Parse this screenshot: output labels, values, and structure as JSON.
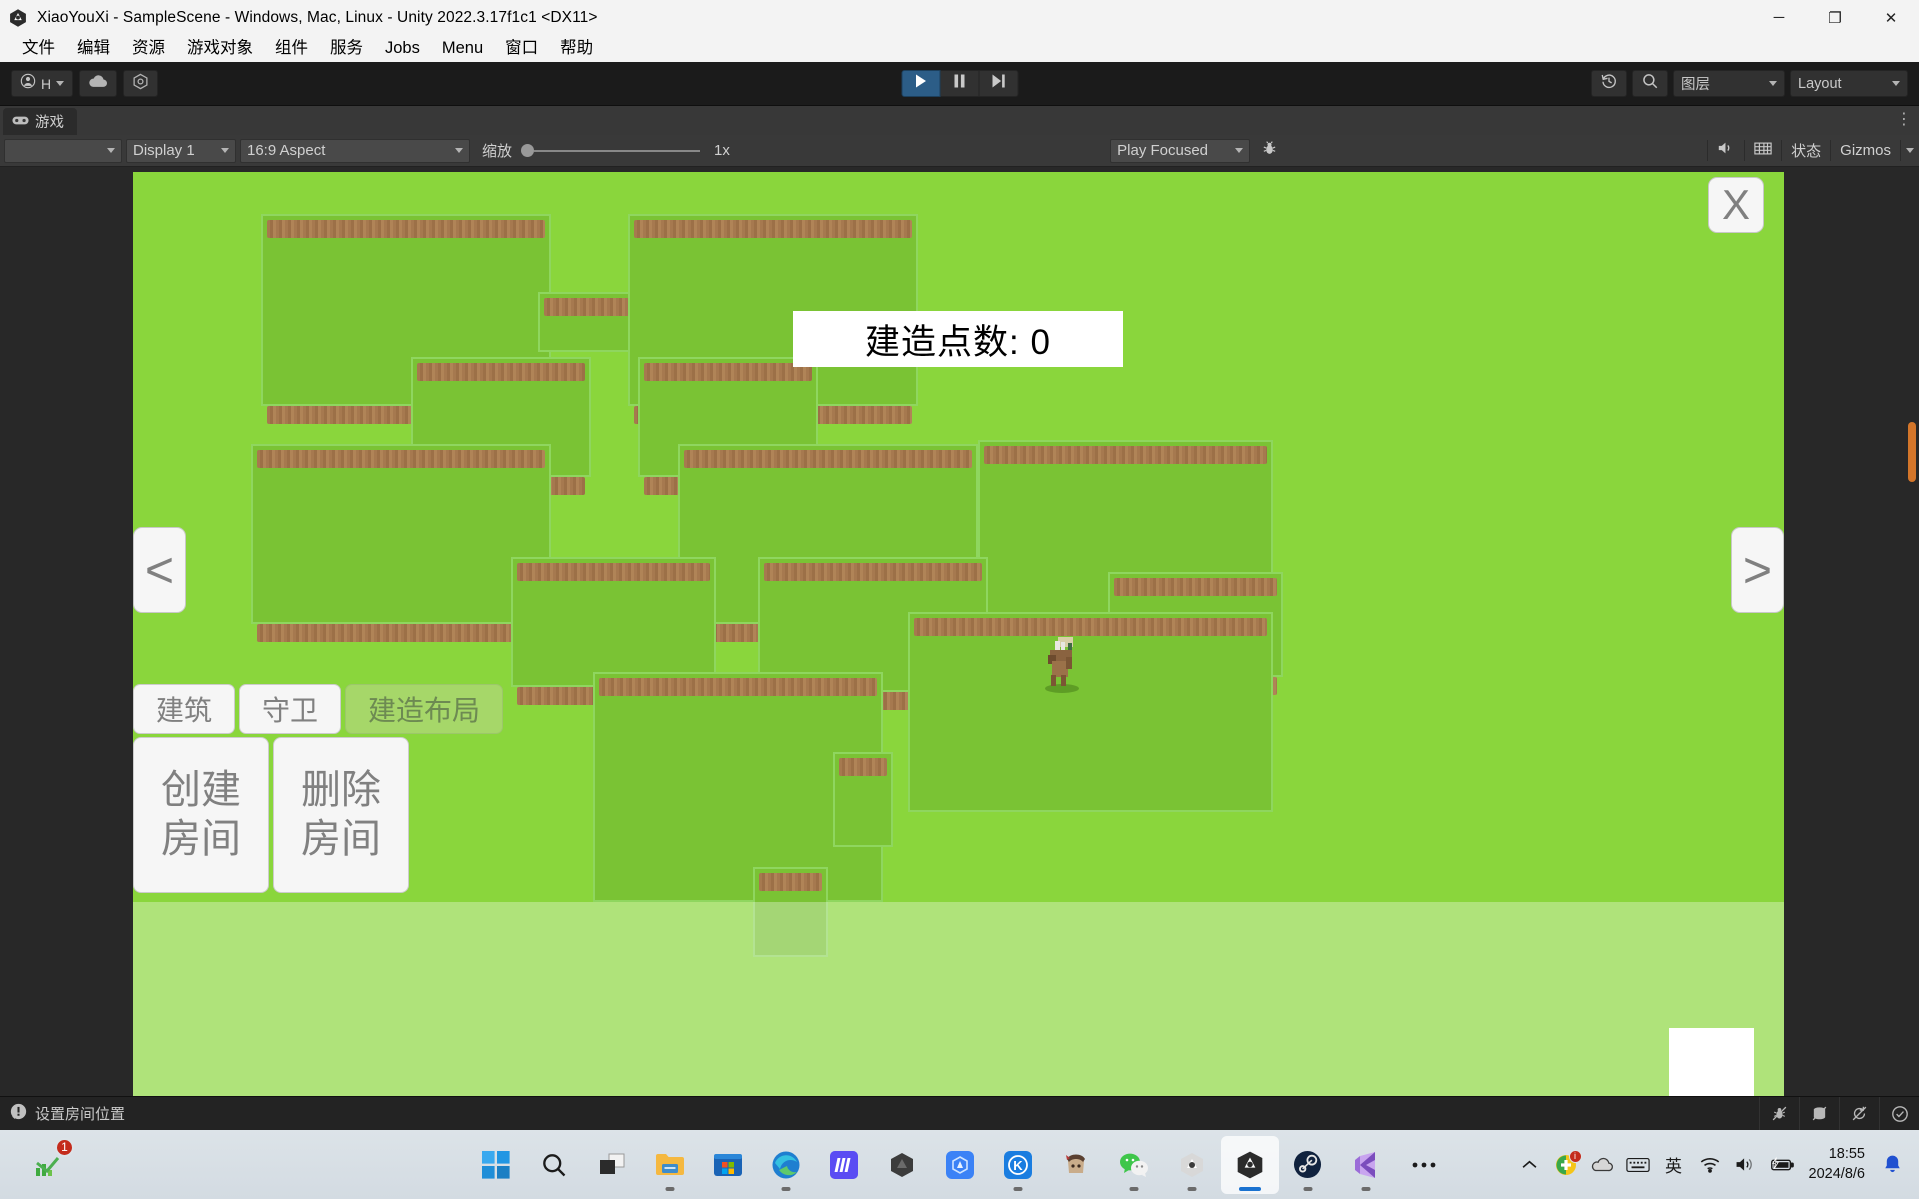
{
  "window": {
    "title": "XiaoYouXi - SampleScene - Windows, Mac, Linux - Unity 2022.3.17f1c1 <DX11>",
    "minimize_label": "─",
    "maximize_label": "❐",
    "close_label": "✕"
  },
  "menubar": {
    "items": [
      {
        "label": "文件"
      },
      {
        "label": "编辑"
      },
      {
        "label": "资源"
      },
      {
        "label": "游戏对象"
      },
      {
        "label": "组件"
      },
      {
        "label": "服务"
      },
      {
        "label": "Jobs"
      },
      {
        "label": "Menu"
      },
      {
        "label": "窗口"
      },
      {
        "label": "帮助"
      }
    ]
  },
  "toolbar": {
    "account_label": "H",
    "account_icon": "user-circle-icon",
    "cloud_icon": "cloud-icon",
    "settings_icon": "unity-services-icon",
    "play_icon": "play-icon",
    "pause_icon": "pause-icon",
    "step_icon": "step-forward-icon",
    "history_icon": "undo-history-icon",
    "search_icon": "search-icon",
    "layers_label": "图层",
    "layout_label": "Layout"
  },
  "game_tab": {
    "label": "游戏",
    "icon": "gamepad-icon",
    "overflow_label": "⋮"
  },
  "gameview_toolbar": {
    "blank_dropdown_label": "",
    "display_label": "Display 1",
    "aspect_label": "16:9 Aspect",
    "zoom_label": "缩放",
    "zoom_value": "1x",
    "play_mode_label": "Play Focused",
    "bug_icon": "debug-bug-icon",
    "mute_icon": "audio-speaker-icon",
    "stats_icon": "grid-icon",
    "stats_label": "状态",
    "gizmos_label": "Gizmos",
    "gizmos_caret": "▾"
  },
  "game": {
    "points_label": "建造点数: 0",
    "close_button": "X",
    "prev_button": "<",
    "next_button": ">",
    "tabs": [
      {
        "label": "建筑",
        "active": false
      },
      {
        "label": "守卫",
        "active": false
      },
      {
        "label": "建造布局",
        "active": true
      }
    ],
    "room_buttons": [
      {
        "line1": "创建",
        "line2": "房间"
      },
      {
        "line1": "删除",
        "line2": "房间"
      }
    ],
    "character": "boar-creature-sprite",
    "colors": {
      "grass": "#8ad63c",
      "room_floor": "#7ac334",
      "wall_dirt": "#a6794f",
      "room_outline": "#8fe05f"
    }
  },
  "statusbar": {
    "message": "设置房间位置",
    "message_icon": "info-bubble-icon",
    "icons": [
      {
        "name": "bug-muted-icon"
      },
      {
        "name": "database-muted-icon"
      },
      {
        "name": "refresh-muted-icon"
      },
      {
        "name": "check-circle-icon"
      }
    ]
  },
  "taskbar": {
    "tray_left": {
      "name": "network-monitor-icon",
      "badge": "1"
    },
    "apps": [
      {
        "name": "windows-start-icon",
        "running": false,
        "active": false
      },
      {
        "name": "search-icon",
        "running": false,
        "active": false
      },
      {
        "name": "task-view-icon",
        "running": false,
        "active": false
      },
      {
        "name": "file-explorer-icon",
        "running": true,
        "active": false
      },
      {
        "name": "microsoft-store-icon",
        "running": false,
        "active": false
      },
      {
        "name": "microsoft-edge-icon",
        "running": true,
        "active": false
      },
      {
        "name": "app-blue-gradient-icon",
        "running": false,
        "active": false
      },
      {
        "name": "unity-hub-dark-icon",
        "running": false,
        "active": false
      },
      {
        "name": "app-blue-hex-icon",
        "running": false,
        "active": false
      },
      {
        "name": "kugou-k-icon",
        "running": true,
        "active": false
      },
      {
        "name": "anime-avatar-icon",
        "running": false,
        "active": false
      },
      {
        "name": "wechat-icon",
        "running": true,
        "active": false
      },
      {
        "name": "unity-light-icon",
        "running": true,
        "active": false
      },
      {
        "name": "unity-editor-icon",
        "running": true,
        "active": true
      },
      {
        "name": "steam-icon",
        "running": true,
        "active": false
      },
      {
        "name": "visual-studio-icon",
        "running": true,
        "active": false
      },
      {
        "name": "more-options-icon",
        "running": false,
        "active": false
      }
    ],
    "tray_right": [
      {
        "name": "chevron-up-icon"
      },
      {
        "name": "360-security-icon",
        "badge": "i"
      },
      {
        "name": "onedrive-icon"
      },
      {
        "name": "keyboard-icon"
      },
      {
        "name": "ime-english-icon",
        "label": "英"
      },
      {
        "name": "wifi-icon"
      },
      {
        "name": "volume-icon"
      },
      {
        "name": "battery-charging-icon"
      }
    ],
    "clock": {
      "time": "18:55",
      "date": "2024/8/6"
    },
    "notification_icon": "bell-icon"
  }
}
